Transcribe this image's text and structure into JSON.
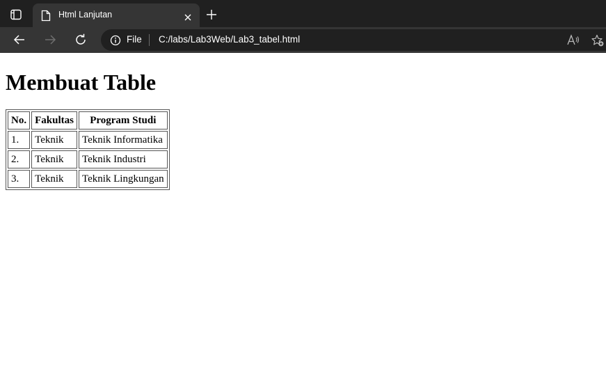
{
  "browser": {
    "tab": {
      "title": "Html Lanjutan"
    },
    "address_bar": {
      "site_label": "File",
      "url": "C:/labs/Lab3Web/Lab3_tabel.html"
    },
    "icons": {
      "tab_actions": "tab-actions-icon",
      "page": "page-icon",
      "close": "close-icon",
      "new_tab": "plus-icon",
      "back": "back-arrow-icon",
      "forward": "forward-arrow-icon",
      "refresh": "refresh-icon",
      "site_info": "info-icon",
      "read_aloud": "read-aloud-icon",
      "favorites": "favorite-add-icon"
    },
    "colors": {
      "tabstrip": "#202020",
      "toolbar": "#353535",
      "active_tab": "#353535",
      "address_field": "#202020",
      "text": "#ffffff"
    }
  },
  "page": {
    "heading": "Membuat Table",
    "table": {
      "headers": [
        "No.",
        "Fakultas",
        "Program Studi"
      ],
      "rows": [
        [
          "1.",
          "Teknik",
          "Teknik Informatika"
        ],
        [
          "2.",
          "Teknik",
          "Teknik Industri"
        ],
        [
          "3.",
          "Teknik",
          "Teknik Lingkungan"
        ]
      ]
    }
  }
}
